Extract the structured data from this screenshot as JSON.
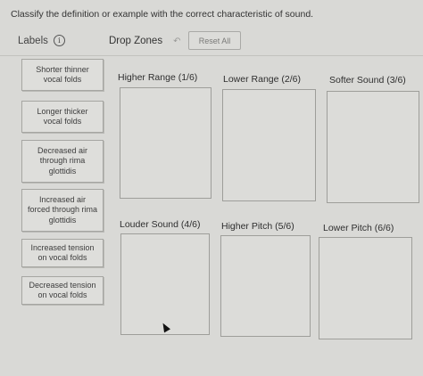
{
  "instruction": "Classify the definition or example with the correct characteristic of sound.",
  "labels_panel": {
    "title": "Labels",
    "info_icon": "ⓘ",
    "items": [
      {
        "line1": "Shorter thinner",
        "line2": "vocal folds",
        "line3": ""
      },
      {
        "line1": "Longer thicker",
        "line2": "vocal folds",
        "line3": ""
      },
      {
        "line1": "Decreased air",
        "line2": "through rima",
        "line3": "glottidis"
      },
      {
        "line1": "Increased air",
        "line2": "forced through rima",
        "line3": "glottidis"
      },
      {
        "line1": "Increased tension",
        "line2": "on vocal folds",
        "line3": ""
      },
      {
        "line1": "Decreased tension",
        "line2": "on vocal folds",
        "line3": ""
      }
    ]
  },
  "drop_zones": {
    "title": "Drop Zones",
    "undo_icon": "↶",
    "reset_label": "Reset All",
    "zones": [
      {
        "title": "Higher Range (1/6)"
      },
      {
        "title": "Lower Range (2/6)"
      },
      {
        "title": "Softer Sound (3/6)"
      },
      {
        "title": "Louder Sound (4/6)"
      },
      {
        "title": "Higher Pitch (5/6)"
      },
      {
        "title": "Lower Pitch (6/6)"
      }
    ]
  }
}
